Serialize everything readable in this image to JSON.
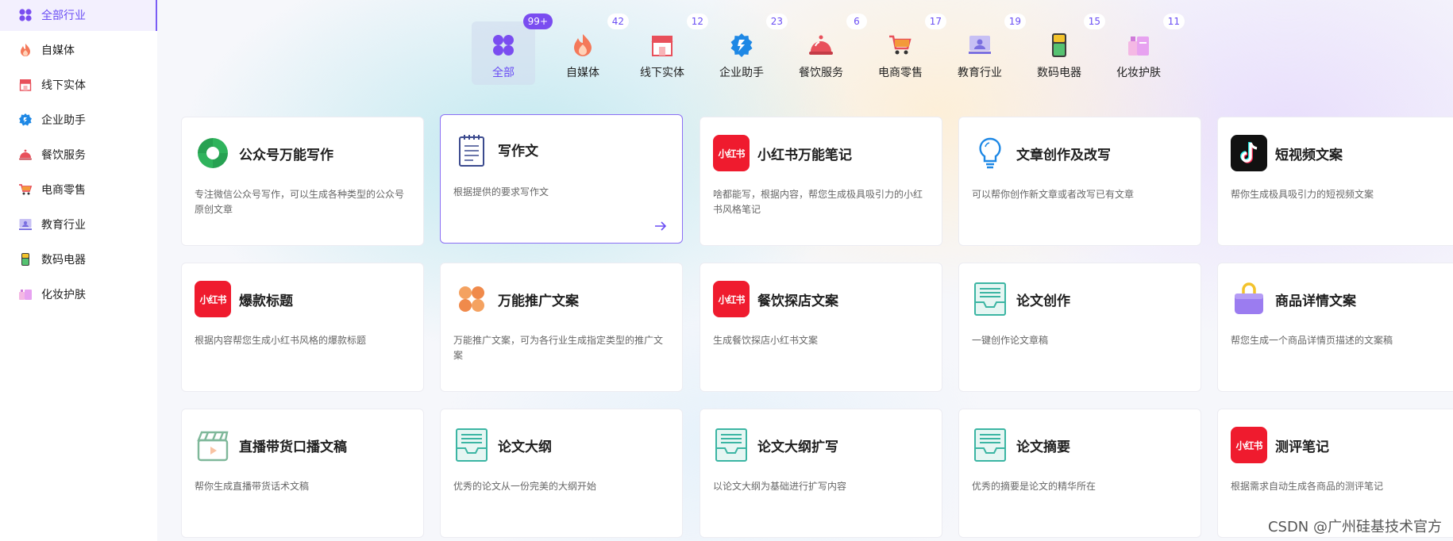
{
  "sidebar": {
    "items": [
      {
        "label": "全部行业"
      },
      {
        "label": "自媒体"
      },
      {
        "label": "线下实体"
      },
      {
        "label": "企业助手"
      },
      {
        "label": "餐饮服务"
      },
      {
        "label": "电商零售"
      },
      {
        "label": "教育行业"
      },
      {
        "label": "数码电器"
      },
      {
        "label": "化妆护肤"
      }
    ]
  },
  "categories": [
    {
      "label": "全部",
      "count": "99+"
    },
    {
      "label": "自媒体",
      "count": "42"
    },
    {
      "label": "线下实体",
      "count": "12"
    },
    {
      "label": "企业助手",
      "count": "23"
    },
    {
      "label": "餐饮服务",
      "count": "6"
    },
    {
      "label": "电商零售",
      "count": "17"
    },
    {
      "label": "教育行业",
      "count": "19"
    },
    {
      "label": "数码电器",
      "count": "15"
    },
    {
      "label": "化妆护肤",
      "count": "11"
    }
  ],
  "cards": [
    {
      "title": "公众号万能写作",
      "desc": "专注微信公众号写作，可以生成各种类型的公众号原创文章",
      "icon": "wechat-icon"
    },
    {
      "title": "写作文",
      "desc": "根据提供的要求写作文",
      "icon": "notepad-icon"
    },
    {
      "title": "小红书万能笔记",
      "desc": "啥都能写，根据内容，帮您生成极具吸引力的小红书风格笔记",
      "icon": "xiaohongshu-logo"
    },
    {
      "title": "文章创作及改写",
      "desc": "可以帮你创作新文章或者改写已有文章",
      "icon": "lightbulb-icon"
    },
    {
      "title": "短视频文案",
      "desc": "帮你生成极具吸引力的短视频文案",
      "icon": "tiktok-icon"
    },
    {
      "title": "爆款标题",
      "desc": "根据内容帮您生成小红书风格的爆款标题",
      "icon": "xiaohongshu-logo"
    },
    {
      "title": "万能推广文案",
      "desc": "万能推广文案，可为各行业生成指定类型的推广文案",
      "icon": "clover-icon"
    },
    {
      "title": "餐饮探店文案",
      "desc": "生成餐饮探店小红书文案",
      "icon": "xiaohongshu-logo"
    },
    {
      "title": "论文创作",
      "desc": "一键创作论文章稿",
      "icon": "document-tray-icon"
    },
    {
      "title": "商品详情文案",
      "desc": "帮您生成一个商品详情页描述的文案稿",
      "icon": "shopping-bag-icon"
    },
    {
      "title": "直播带货口播文稿",
      "desc": "帮你生成直播带货话术文稿",
      "icon": "clapperboard-icon"
    },
    {
      "title": "论文大纲",
      "desc": "优秀的论文从一份完美的大纲开始",
      "icon": "document-tray-icon"
    },
    {
      "title": "论文大纲扩写",
      "desc": "以论文大纲为基础进行扩写内容",
      "icon": "document-tray-icon"
    },
    {
      "title": "论文摘要",
      "desc": "优秀的摘要是论文的精华所在",
      "icon": "document-tray-icon"
    },
    {
      "title": "测评笔记",
      "desc": "根据需求自动生成各商品的测评笔记",
      "icon": "xiaohongshu-logo"
    }
  ],
  "xhs_logo_text": "小红书",
  "watermark": "CSDN @广州硅基技术官方",
  "colors": {
    "accent": "#6a4df4",
    "xhs_red": "#ef1b2e"
  }
}
